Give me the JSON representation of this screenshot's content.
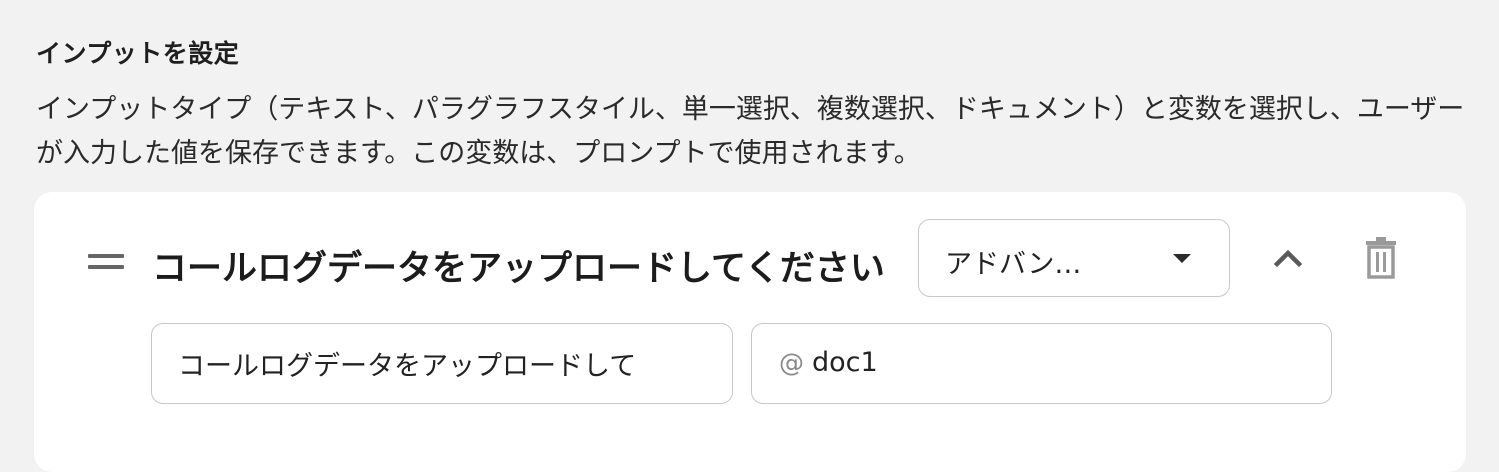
{
  "section": {
    "title": "インプットを設定",
    "description": "インプットタイプ（テキスト、パラグラフスタイル、単一選択、複数選択、ドキュメント）と変数を選択し、ユーザーが入力した値を保存できます。この変数は、プロンプトで使用されます。"
  },
  "input_item": {
    "title": "コールログデータをアップロードしてください",
    "type_select": {
      "value": "アドバン…"
    },
    "label_field": {
      "value": "コールログデータをアップロードして"
    },
    "variable_field": {
      "prefix": "@",
      "value": "doc1"
    },
    "icons": {
      "drag": "drag-handle-icon",
      "caret": "caret-down-icon",
      "collapse": "chevron-up-icon",
      "delete": "trash-icon"
    }
  },
  "colors": {
    "background": "#f2f2f2",
    "card": "#ffffff",
    "border": "#c9c9c9",
    "icon_muted": "#9a9a9a"
  }
}
